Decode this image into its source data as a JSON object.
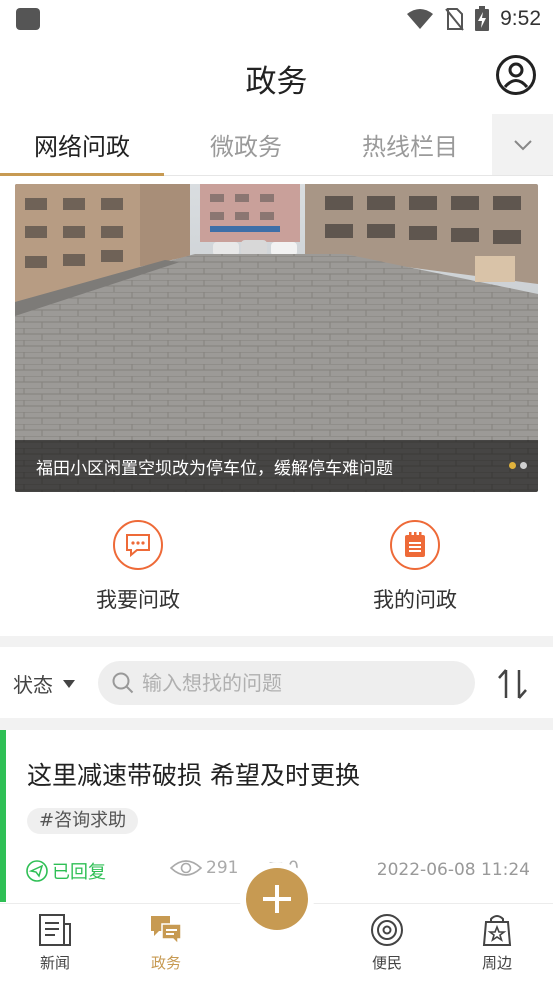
{
  "status_bar": {
    "time": "9:52"
  },
  "header": {
    "title": "政务"
  },
  "tabs": [
    {
      "label": "网络问政",
      "active": true
    },
    {
      "label": "微政务",
      "active": false
    },
    {
      "label": "热线栏目",
      "active": false
    }
  ],
  "banner": {
    "caption": "福田小区闲置空坝改为停车位，缓解停车难问题",
    "slide_count": 2,
    "active_slide": 1
  },
  "actions": [
    {
      "label": "我要问政",
      "icon": "chat-bubble-icon"
    },
    {
      "label": "我的问政",
      "icon": "notepad-icon"
    }
  ],
  "filter": {
    "status_label": "状态",
    "search_placeholder": "输入想找的问题"
  },
  "posts": [
    {
      "title": "这里减速带破损 希望及时更换",
      "tag": "#咨询求助",
      "reply_status": "已回复",
      "views": "291",
      "comments": "0",
      "time": "2022-06-08 11:24"
    }
  ],
  "bottom_nav": [
    {
      "label": "新闻",
      "icon": "newspaper-icon",
      "active": false
    },
    {
      "label": "政务",
      "icon": "chat-icon",
      "active": true
    },
    {
      "label": "便民",
      "icon": "disc-icon",
      "active": false
    },
    {
      "label": "周边",
      "icon": "shopping-bag-icon",
      "active": false
    }
  ],
  "colors": {
    "accent": "#c79a52",
    "action_orange": "#ee6a38",
    "replied_green": "#2fbf55"
  }
}
